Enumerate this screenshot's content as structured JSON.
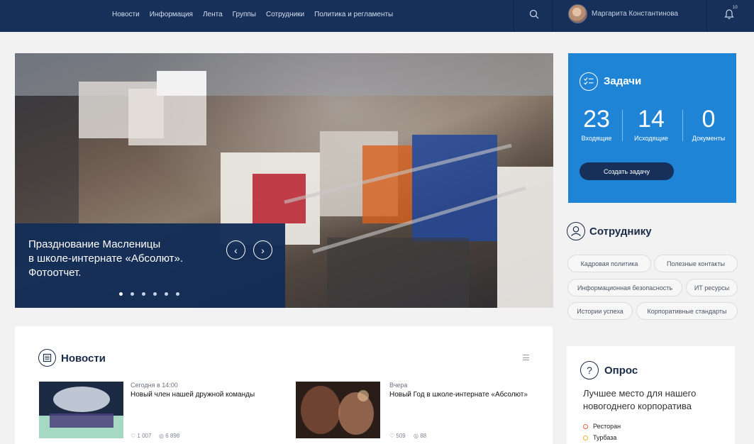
{
  "nav": {
    "items": [
      "Новости",
      "Информация",
      "Лента",
      "Группы",
      "Сотрудники",
      "Политика и регламенты"
    ],
    "user_name": "Маргарита Константинова",
    "notification_count": "10",
    "icons": {
      "search": "search-icon",
      "bell": "bell-icon"
    }
  },
  "slider": {
    "caption_lines": [
      "Празднование Масленицы",
      "в школе-интернате «Абсолют».",
      "Фотоотчет."
    ],
    "slide_count": 6,
    "active_slide": 1,
    "prev_label": "‹",
    "next_label": "›"
  },
  "tasks": {
    "title": "Задачи",
    "stats": [
      {
        "value": "23",
        "label": "Входящие"
      },
      {
        "value": "14",
        "label": "Исходящие"
      },
      {
        "value": "0",
        "label": "Документы"
      }
    ],
    "create_label": "Создать задачу",
    "colors": {
      "card": "#1f84d5",
      "button": "#16305a"
    }
  },
  "employee": {
    "title": "Сотруднику",
    "chips": [
      "Кадровая политика",
      "Полезные контакты",
      "Информационная безопасность",
      "ИТ ресурсы",
      "Истории успеха",
      "Корпоративные стандарты"
    ]
  },
  "news": {
    "title": "Новости",
    "items": [
      {
        "time": "Сегодня в 14:00",
        "headline": "Новый член нашей дружной команды",
        "likes": "♡ 1 007",
        "views": "◎ 6 898"
      },
      {
        "time": "Вчера",
        "headline": "Новый Год в школе-интернате «Абсолют»",
        "likes": "♡ 509",
        "views": "◎ 88"
      }
    ]
  },
  "poll": {
    "title": "Опрос",
    "question_lines": [
      "Лучшее место для нашего",
      "новогоднего корпоратива"
    ],
    "options": [
      "Ресторан",
      "Турбаза"
    ]
  },
  "colors": {
    "header": "#16305a",
    "accent_orange": "#e0663a"
  }
}
